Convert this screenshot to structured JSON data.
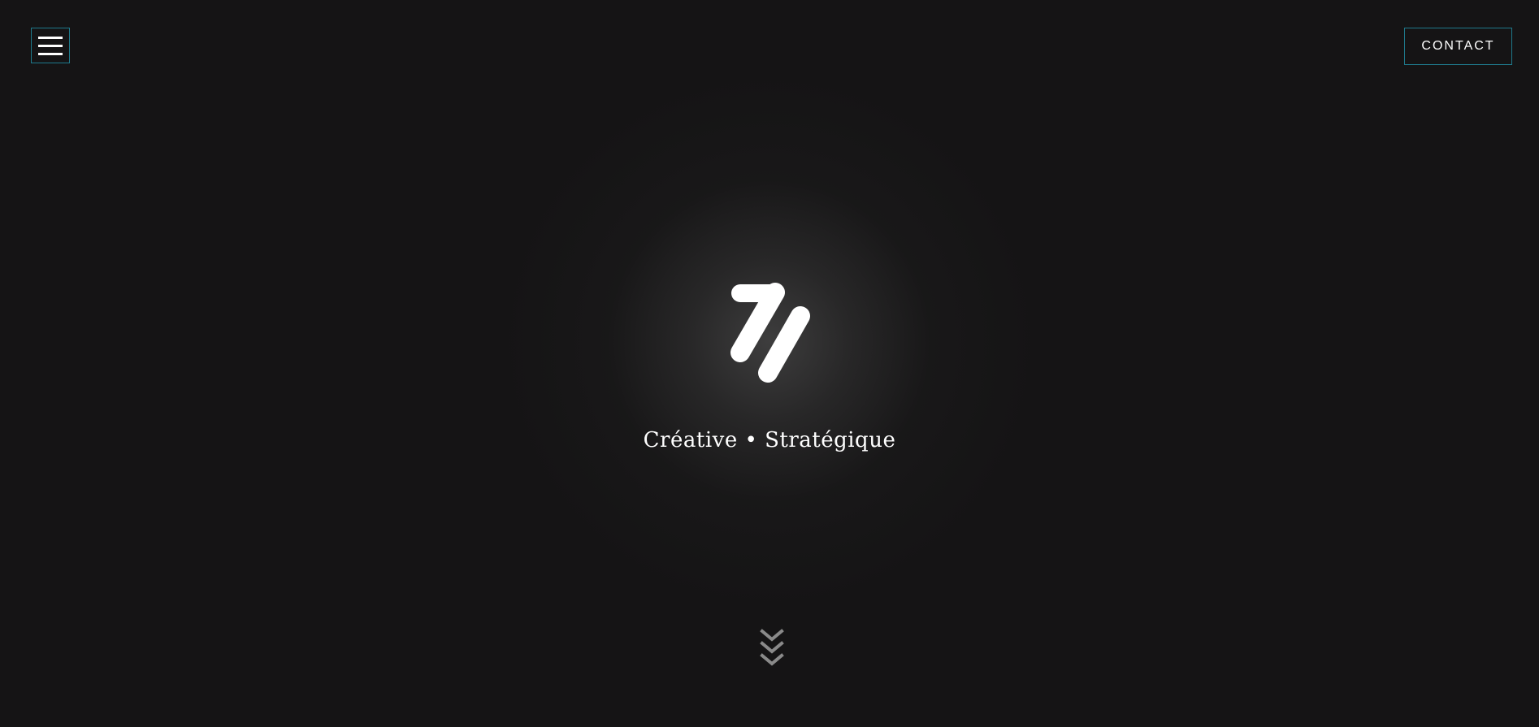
{
  "header": {
    "menu_icon": "hamburger-menu-icon",
    "contact_label": "CONTACT"
  },
  "hero": {
    "logo_icon": "brand-logo-icon",
    "tagline": "Créative • Stratégique",
    "scroll_icon": "triple-chevron-down-icon"
  },
  "colors": {
    "background": "#151415",
    "accent_border": "#1f7a8c",
    "text": "#ffffff",
    "chevron": "#8a8a8a"
  }
}
